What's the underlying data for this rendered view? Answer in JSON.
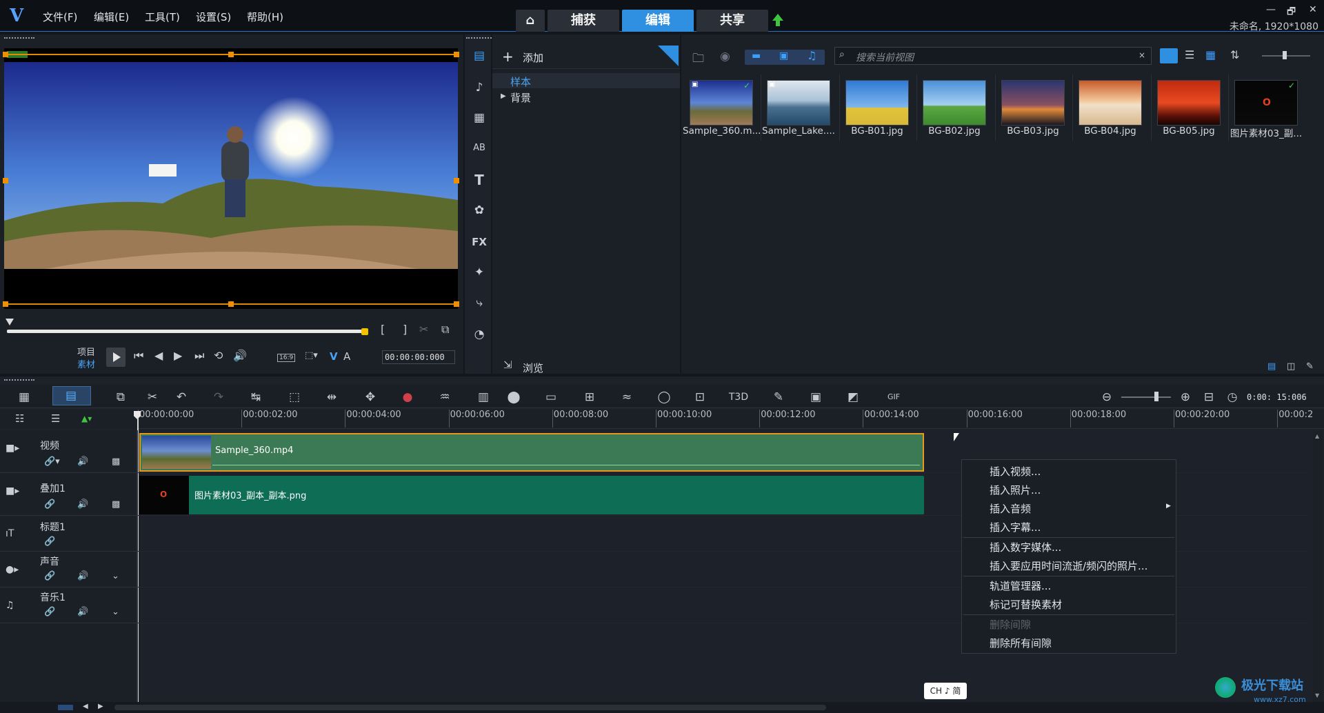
{
  "menu": [
    "文件(F)",
    "编辑(E)",
    "工具(T)",
    "设置(S)",
    "帮助(H)"
  ],
  "nav": {
    "home": "⌂",
    "tabs": [
      "捕获",
      "编辑",
      "共享"
    ],
    "active": 1
  },
  "window": {
    "min": "—",
    "restore": "🗗",
    "close": "✕"
  },
  "project_info": "未命名, 1920*1080",
  "preview": {
    "label_project": "项目",
    "label_clip": "素材",
    "aspect": "16:9",
    "timecode": "00:00:00:000",
    "in_mark": "[",
    "out_mark": "]",
    "va_v": "V",
    "va_a": "A"
  },
  "library": {
    "add_label": "添加",
    "folders": [
      "样本",
      "背景"
    ],
    "browse_label": "浏览",
    "search_placeholder": "搜索当前视图",
    "items": [
      {
        "name": "Sample_360.m...",
        "kind": "video"
      },
      {
        "name": "Sample_Lake....",
        "kind": "video"
      },
      {
        "name": "BG-B01.jpg",
        "kind": "image"
      },
      {
        "name": "BG-B02.jpg",
        "kind": "image"
      },
      {
        "name": "BG-B03.jpg",
        "kind": "image"
      },
      {
        "name": "BG-B04.jpg",
        "kind": "image"
      },
      {
        "name": "BG-B05.jpg",
        "kind": "image"
      },
      {
        "name": "图片素材03_副...",
        "kind": "image"
      }
    ]
  },
  "timeline": {
    "zoom_timecode": "0:00: 15:006",
    "ruler": [
      "00:00:00:00",
      "00:00:02:00",
      "00:00:04:00",
      "00:00:06:00",
      "00:00:08:00",
      "00:00:10:00",
      "00:00:12:00",
      "00:00:14:00",
      "00:00:16:00",
      "00:00:18:00",
      "00:00:20:00",
      "00:00:2"
    ],
    "tracks": [
      "视频",
      "叠加1",
      "标题1",
      "声音",
      "音乐1"
    ],
    "clips": {
      "video": "Sample_360.mp4",
      "overlay": "图片素材03_副本_副本.png"
    }
  },
  "context_menu": {
    "items": [
      {
        "label": "插入视频...",
        "enabled": true
      },
      {
        "label": "插入照片...",
        "enabled": true
      },
      {
        "label": "插入音频",
        "enabled": true,
        "submenu": true
      },
      {
        "label": "插入字幕...",
        "enabled": true
      },
      {
        "label": "插入数字媒体...",
        "enabled": true
      },
      {
        "label": "插入要应用时间流逝/频闪的照片...",
        "enabled": true
      },
      {
        "label": "轨道管理器...",
        "enabled": true
      },
      {
        "label": "标记可替换素材",
        "enabled": true
      },
      {
        "label": "删除间隙",
        "enabled": false
      },
      {
        "label": "删除所有间隙",
        "enabled": true
      }
    ]
  },
  "ime": "CH ♪ 简",
  "watermark": {
    "brand": "极光下载站",
    "url": "www.xz7.com"
  }
}
